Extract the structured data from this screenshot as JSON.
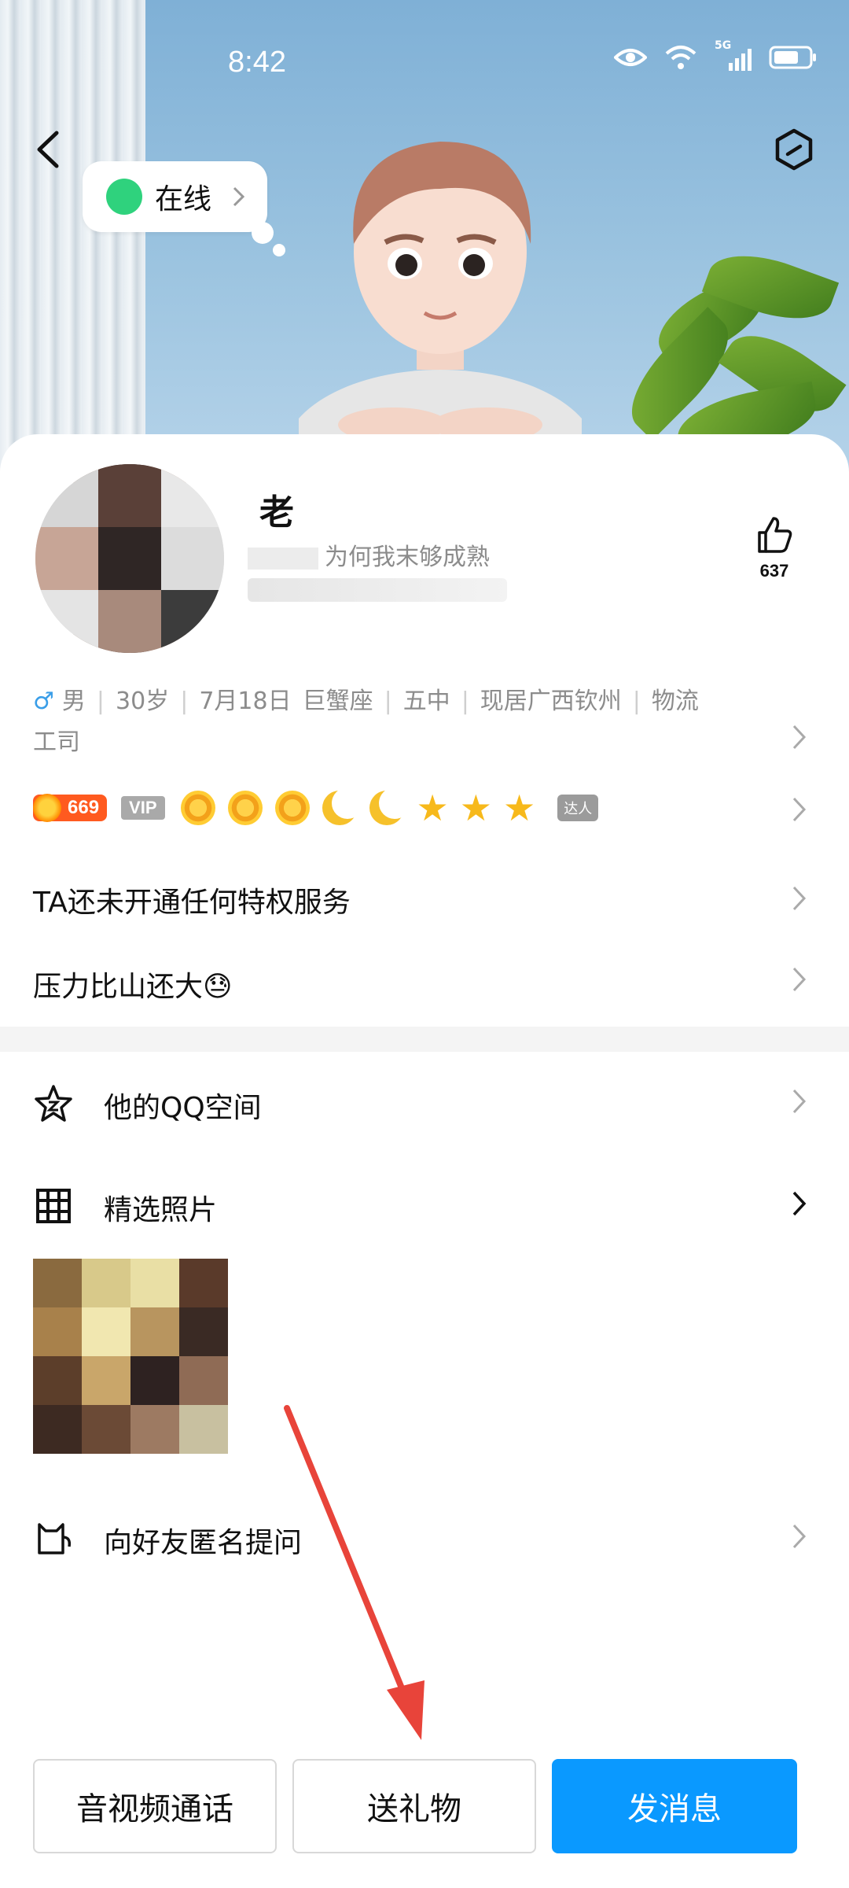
{
  "status_bar": {
    "time": "8:42",
    "network": "5G"
  },
  "header": {
    "online_status": "在线"
  },
  "profile": {
    "name": "老",
    "signature": "为何我末够成熟",
    "likes": "637"
  },
  "info_line": {
    "gender": "♂",
    "items": [
      "男",
      "30岁",
      "7月18日",
      "巨蟹座",
      "五中",
      "现居广西钦州",
      "物流"
    ],
    "second_line": "工司"
  },
  "badges": {
    "level": "669",
    "vip": "VIP",
    "daren": "达人"
  },
  "rows": {
    "privilege": "TA还未开通任何特权服务",
    "mood": "压力比山还大😓"
  },
  "menu": {
    "qzone": "他的QQ空间",
    "photos": "精选照片",
    "anonymous": "向好友匿名提问"
  },
  "buttons": {
    "call": "音视频通话",
    "gift": "送礼物",
    "message": "发消息"
  },
  "colors": {
    "primary": "#0a99ff",
    "online": "#2fd27d",
    "level": "#ff5a1f",
    "arrow": "#e8443a"
  }
}
